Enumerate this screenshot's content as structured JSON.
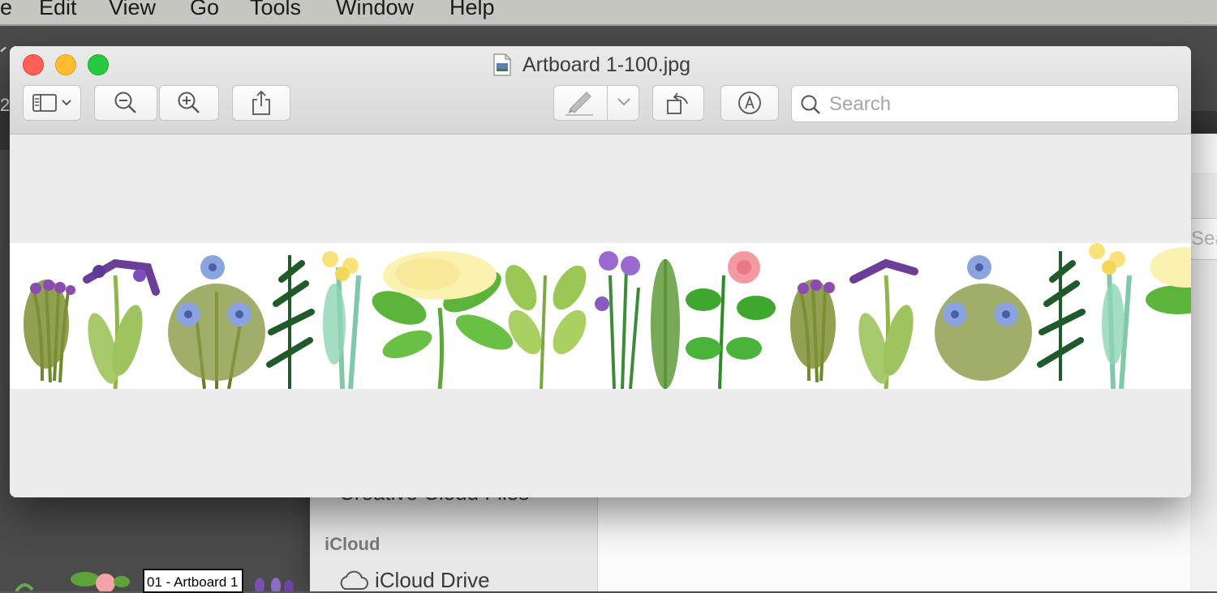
{
  "menubar": {
    "items": [
      "e",
      "Edit",
      "View",
      "Go",
      "Tools",
      "Window",
      "Help"
    ]
  },
  "background_app": {
    "left_text": "2",
    "thumbnail_label": "01 - Artboard 1"
  },
  "finder": {
    "search_fragment": "Sea",
    "creative_cloud_item": "Creative Cloud Files",
    "icloud_heading": "iCloud",
    "icloud_drive_item": "iCloud Drive"
  },
  "preview_window": {
    "title": "Artboard 1-100.jpg",
    "toolbar": {
      "sidebar_icon": "sidebar-icon",
      "zoom_out_icon": "zoom-out-icon",
      "zoom_in_icon": "zoom-in-icon",
      "share_icon": "share-icon",
      "markup_icon": "highlighter-icon",
      "rotate_icon": "rotate-icon",
      "annotate_icon": "markup-pen-icon"
    },
    "search": {
      "placeholder": "Search",
      "value": ""
    },
    "image": {
      "description": "botanical herbs border"
    }
  },
  "colors": {
    "close": "#fe5f57",
    "minimize": "#febc2e",
    "maximize": "#28c840",
    "content_bg": "#ececec"
  }
}
